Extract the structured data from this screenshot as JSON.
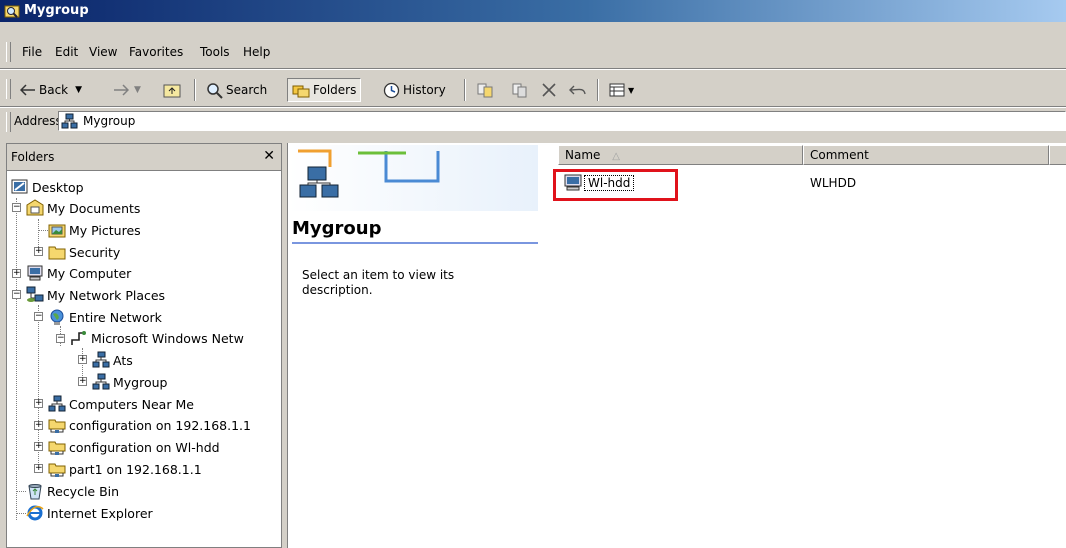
{
  "window": {
    "title": "Mygroup"
  },
  "menu": [
    "File",
    "Edit",
    "View",
    "Favorites",
    "Tools",
    "Help"
  ],
  "toolbar": {
    "back_label": "Back",
    "search_label": "Search",
    "folders_label": "Folders",
    "history_label": "History"
  },
  "address": {
    "label": "Address",
    "value": "Mygroup"
  },
  "folders_pane": {
    "title": "Folders",
    "tree": [
      "Desktop",
      "My Documents",
      "My Pictures",
      "Security",
      "My Computer",
      "My Network Places",
      "Entire Network",
      "Microsoft Windows Netw",
      "Ats",
      "Mygroup",
      "Computers Near Me",
      "configuration on 192.168.1.1",
      "configuration on Wl-hdd",
      "part1 on 192.168.1.1",
      "Recycle Bin",
      "Internet Explorer"
    ]
  },
  "webview": {
    "title": "Mygroup",
    "description": "Select an item to view its description."
  },
  "list": {
    "columns": [
      {
        "label": "Name",
        "sorted": "ascending"
      },
      {
        "label": "Comment"
      }
    ],
    "rows": [
      {
        "name": "Wl-hdd",
        "comment": "WLHDD"
      }
    ]
  },
  "colors": {
    "titlebar_start": "#0a246a",
    "titlebar_end": "#a6caf0",
    "highlight": "#e0121b"
  }
}
